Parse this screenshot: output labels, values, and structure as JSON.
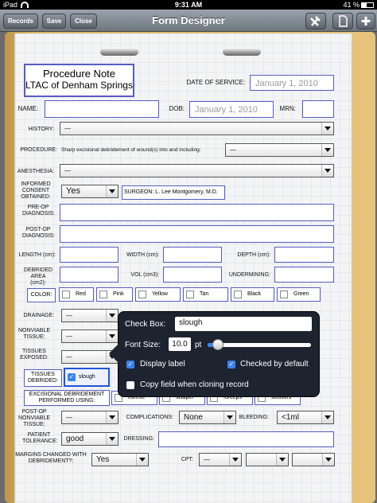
{
  "status": {
    "carrier": "iPad",
    "wifi": "wifi-icon",
    "time": "9:31 AM",
    "battery": "41 %"
  },
  "nav": {
    "records": "Records",
    "save": "Save",
    "close": "Close",
    "title": "Form Designer"
  },
  "form": {
    "title1": "Procedure Note",
    "title2": "LTAC of Denham Springs",
    "date_of_service_label": "DATE OF SERVICE:",
    "date_of_service_value": "January 1, 2010",
    "name_label": "NAME:",
    "dob_label": "DOB:",
    "dob_value": "January 1, 2010",
    "mrn_label": "MRN:",
    "history_label": "HISTORY:",
    "history_value": "—",
    "procedure_label": "PROCEDURE:",
    "procedure_text": "Sharp excisional debridement of wound(s) into and including:",
    "procedure_value": "—",
    "anesthesia_label": "ANESTHESIA:",
    "anesthesia_value": "—",
    "consent_label": "INFORMED CONSENT OBTAINED:",
    "consent_value": "Yes",
    "surgeon_label": "SURGEON:",
    "surgeon_value": "L. Lee Montgomery, M.D.",
    "preop_label": "PRE-OP DIAGNOSIS:",
    "postop_label": "POST-OP DIAGNOSIS:",
    "length_label": "LENGTH (cm):",
    "width_label": "WIDTH (cm):",
    "depth_label": "DEPTH (cm):",
    "debrided_area_label": "DEBRIDED AREA (cm2):",
    "vol_label": "VOL (cm3):",
    "undermining_label": "UNDERMINING:",
    "color_label": "COLOR:",
    "colors": [
      "Red",
      "Pink",
      "Yellow",
      "Tan",
      "Black",
      "Green"
    ],
    "drainage_label": "DRAINAGE:",
    "drainage_value": "—",
    "nonviable_label": "NONVIABLE TISSUE:",
    "nonviable_value": "—",
    "tissues_exposed_label": "TISSUES EXPOSED:",
    "tissues_exposed_value": "—",
    "tissues_debrided_label": "TISSUES DEBRIDED:",
    "slough_label": "slough",
    "excisional_label": "EXCISIONAL DEBRIDEMENT PERFORMED USING:",
    "instruments": [
      "curette",
      "scalpel",
      "forceps",
      "scissors"
    ],
    "postop_nonviable_label": "POST-OP NONVIABLE TISSUE:",
    "postop_nonviable_value": "—",
    "complications_label": "COMPLICATIONS:",
    "complications_value": "None",
    "bleeding_label": "BLEEDING:",
    "bleeding_value": "<1ml",
    "tolerance_label": "PATIENT TOLERANCE:",
    "tolerance_value": "good",
    "dressing_label": "DRESSING:",
    "margins_label": "MARGINS CHANGED WITH DEBRIDEMENT?:",
    "margins_value": "Yes",
    "cpt_label": "CPT:",
    "cpt1": "—"
  },
  "popover": {
    "checkbox_label": "Check Box:",
    "checkbox_value": "slough",
    "font_size_label": "Font Size:",
    "font_size_value": "10.0",
    "font_unit": "pt",
    "font_slider_fraction": 0.1,
    "display_label": "Display label",
    "display_checked": true,
    "checked_default": "Checked by default",
    "checked_default_checked": true,
    "copy_label": "Copy field when cloning record",
    "copy_checked": false
  }
}
